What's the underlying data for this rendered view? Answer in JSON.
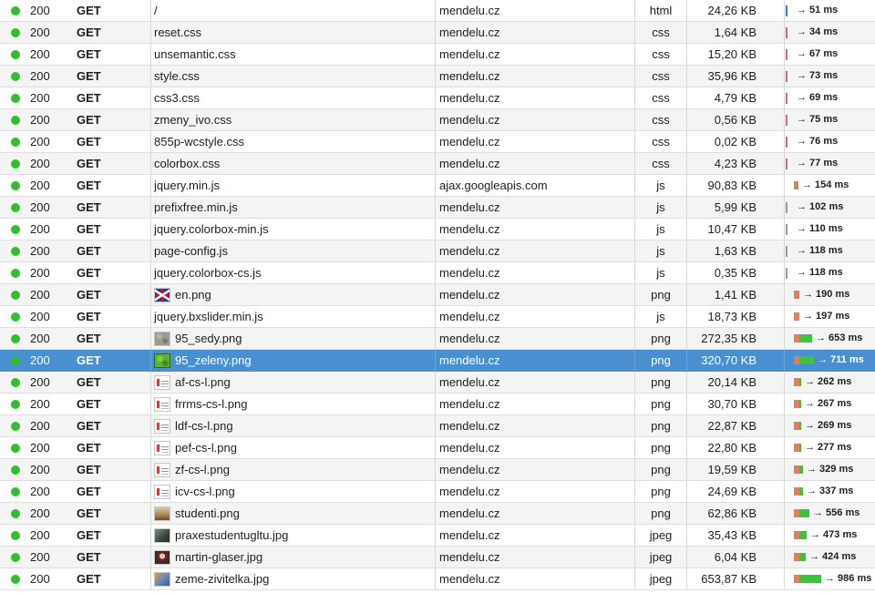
{
  "requests": [
    {
      "status": "200",
      "method": "GET",
      "file": "/",
      "domain": "mendelu.cz",
      "type": "html",
      "size": "24,26 KB",
      "time": "→ 51 ms",
      "icon": "",
      "ms": 51
    },
    {
      "status": "200",
      "method": "GET",
      "file": "reset.css",
      "domain": "mendelu.cz",
      "type": "css",
      "size": "1,64 KB",
      "time": "→ 34 ms",
      "icon": "",
      "ms": 34
    },
    {
      "status": "200",
      "method": "GET",
      "file": "unsemantic.css",
      "domain": "mendelu.cz",
      "type": "css",
      "size": "15,20 KB",
      "time": "→ 67 ms",
      "icon": "",
      "ms": 67
    },
    {
      "status": "200",
      "method": "GET",
      "file": "style.css",
      "domain": "mendelu.cz",
      "type": "css",
      "size": "35,96 KB",
      "time": "→ 73 ms",
      "icon": "",
      "ms": 73
    },
    {
      "status": "200",
      "method": "GET",
      "file": "css3.css",
      "domain": "mendelu.cz",
      "type": "css",
      "size": "4,79 KB",
      "time": "→ 69 ms",
      "icon": "",
      "ms": 69
    },
    {
      "status": "200",
      "method": "GET",
      "file": "zmeny_ivo.css",
      "domain": "mendelu.cz",
      "type": "css",
      "size": "0,56 KB",
      "time": "→ 75 ms",
      "icon": "",
      "ms": 75
    },
    {
      "status": "200",
      "method": "GET",
      "file": "855p-wcstyle.css",
      "domain": "mendelu.cz",
      "type": "css",
      "size": "0,02 KB",
      "time": "→ 76 ms",
      "icon": "",
      "ms": 76
    },
    {
      "status": "200",
      "method": "GET",
      "file": "colorbox.css",
      "domain": "mendelu.cz",
      "type": "css",
      "size": "4,23 KB",
      "time": "→ 77 ms",
      "icon": "",
      "ms": 77
    },
    {
      "status": "200",
      "method": "GET",
      "file": "jquery.min.js",
      "domain": "ajax.googleapis.com",
      "type": "js",
      "size": "90,83 KB",
      "time": "→ 154 ms",
      "icon": "",
      "ms": 154
    },
    {
      "status": "200",
      "method": "GET",
      "file": "prefixfree.min.js",
      "domain": "mendelu.cz",
      "type": "js",
      "size": "5,99 KB",
      "time": "→ 102 ms",
      "icon": "",
      "ms": 102
    },
    {
      "status": "200",
      "method": "GET",
      "file": "jquery.colorbox-min.js",
      "domain": "mendelu.cz",
      "type": "js",
      "size": "10,47 KB",
      "time": "→ 110 ms",
      "icon": "",
      "ms": 110
    },
    {
      "status": "200",
      "method": "GET",
      "file": "page-config.js",
      "domain": "mendelu.cz",
      "type": "js",
      "size": "1,63 KB",
      "time": "→ 118 ms",
      "icon": "",
      "ms": 118
    },
    {
      "status": "200",
      "method": "GET",
      "file": "jquery.colorbox-cs.js",
      "domain": "mendelu.cz",
      "type": "js",
      "size": "0,35 KB",
      "time": "→ 118 ms",
      "icon": "",
      "ms": 118
    },
    {
      "status": "200",
      "method": "GET",
      "file": "en.png",
      "domain": "mendelu.cz",
      "type": "png",
      "size": "1,41 KB",
      "time": "→ 190 ms",
      "icon": "flag",
      "ms": 190
    },
    {
      "status": "200",
      "method": "GET",
      "file": "jquery.bxslider.min.js",
      "domain": "mendelu.cz",
      "type": "js",
      "size": "18,73 KB",
      "time": "→ 197 ms",
      "icon": "",
      "ms": 197
    },
    {
      "status": "200",
      "method": "GET",
      "file": "95_sedy.png",
      "domain": "mendelu.cz",
      "type": "png",
      "size": "272,35 KB",
      "time": "→ 653 ms",
      "icon": "grey",
      "ms": 653
    },
    {
      "status": "200",
      "method": "GET",
      "file": "95_zeleny.png",
      "domain": "mendelu.cz",
      "type": "png",
      "size": "320,70 KB",
      "time": "→ 711 ms",
      "icon": "green",
      "ms": 711,
      "selected": true
    },
    {
      "status": "200",
      "method": "GET",
      "file": "af-cs-l.png",
      "domain": "mendelu.cz",
      "type": "png",
      "size": "20,14 KB",
      "time": "→ 262 ms",
      "icon": "doc",
      "ms": 262
    },
    {
      "status": "200",
      "method": "GET",
      "file": "frrms-cs-l.png",
      "domain": "mendelu.cz",
      "type": "png",
      "size": "30,70 KB",
      "time": "→ 267 ms",
      "icon": "doc",
      "ms": 267
    },
    {
      "status": "200",
      "method": "GET",
      "file": "ldf-cs-l.png",
      "domain": "mendelu.cz",
      "type": "png",
      "size": "22,87 KB",
      "time": "→ 269 ms",
      "icon": "doc",
      "ms": 269
    },
    {
      "status": "200",
      "method": "GET",
      "file": "pef-cs-l.png",
      "domain": "mendelu.cz",
      "type": "png",
      "size": "22,80 KB",
      "time": "→ 277 ms",
      "icon": "doc",
      "ms": 277
    },
    {
      "status": "200",
      "method": "GET",
      "file": "zf-cs-l.png",
      "domain": "mendelu.cz",
      "type": "png",
      "size": "19,59 KB",
      "time": "→ 329 ms",
      "icon": "doc",
      "ms": 329
    },
    {
      "status": "200",
      "method": "GET",
      "file": "icv-cs-l.png",
      "domain": "mendelu.cz",
      "type": "png",
      "size": "24,69 KB",
      "time": "→ 337 ms",
      "icon": "doc",
      "ms": 337
    },
    {
      "status": "200",
      "method": "GET",
      "file": "studenti.png",
      "domain": "mendelu.cz",
      "type": "png",
      "size": "62,86 KB",
      "time": "→ 556 ms",
      "icon": "photo1",
      "ms": 556
    },
    {
      "status": "200",
      "method": "GET",
      "file": "praxestudentugltu.jpg",
      "domain": "mendelu.cz",
      "type": "jpeg",
      "size": "35,43 KB",
      "time": "→ 473 ms",
      "icon": "photo2",
      "ms": 473
    },
    {
      "status": "200",
      "method": "GET",
      "file": "martin-glaser.jpg",
      "domain": "mendelu.cz",
      "type": "jpeg",
      "size": "6,04 KB",
      "time": "→ 424 ms",
      "icon": "photo3",
      "ms": 424
    },
    {
      "status": "200",
      "method": "GET",
      "file": "zeme-zivitelka.jpg",
      "domain": "mendelu.cz",
      "type": "jpeg",
      "size": "653,87 KB",
      "time": "→ 986 ms",
      "icon": "photo4",
      "ms": 986
    }
  ],
  "colors": {
    "status_ok": "#2fbf2f",
    "selected_row": "#4a90d0",
    "tick_html": "#4a6fd0",
    "tick_css": "#c07070",
    "tick_js": "#9a9a9a",
    "wait": "#e0805a",
    "receive": "#3cc43c"
  }
}
